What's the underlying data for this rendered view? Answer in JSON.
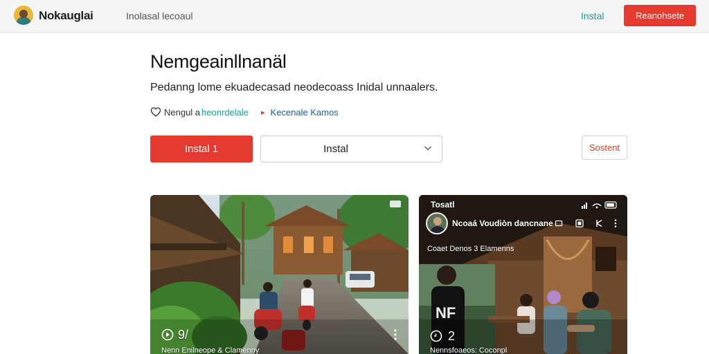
{
  "header": {
    "app_title": "Nokauglai",
    "nav_link": "Inolasal lecoaul",
    "install_link": "Instal",
    "primary_button": "Reanohsete"
  },
  "main": {
    "title": "Nemgeainllnanäl",
    "subtitle": "Pedanng lome ekuadecasad neodecoass Inidal unnaalers.",
    "meta": {
      "left_label": "Nengul a",
      "left_link": "heonrdelale",
      "right_link": "Kecenale Kamos"
    },
    "install_button": "Instal 1",
    "select_value": "Instal",
    "secondary_button": "Sostent"
  },
  "cards": [
    {
      "overlay_count": "9/",
      "overlay_title": "Nenn Enilneope & Clamenny"
    },
    {
      "status_time": "Tosatl",
      "profile_name": "Ncoaá Voudiòn dancnane",
      "caption": "Coaet Denos 3 Elamenns",
      "overlay_count": "2",
      "overlay_title": "Nennsfoaeos: Coconpl"
    }
  ],
  "colors": {
    "accent_red": "#e53a2f",
    "accent_teal": "#1aa39a",
    "link_blue": "#1f5f99"
  },
  "icons": {
    "logo": "avatar-logo",
    "meta_left": "heart-outline-icon",
    "meta_right": "tag-icon",
    "select": "chevron-down-icon",
    "play": "play-icon",
    "more": "more-vertical-icon"
  }
}
